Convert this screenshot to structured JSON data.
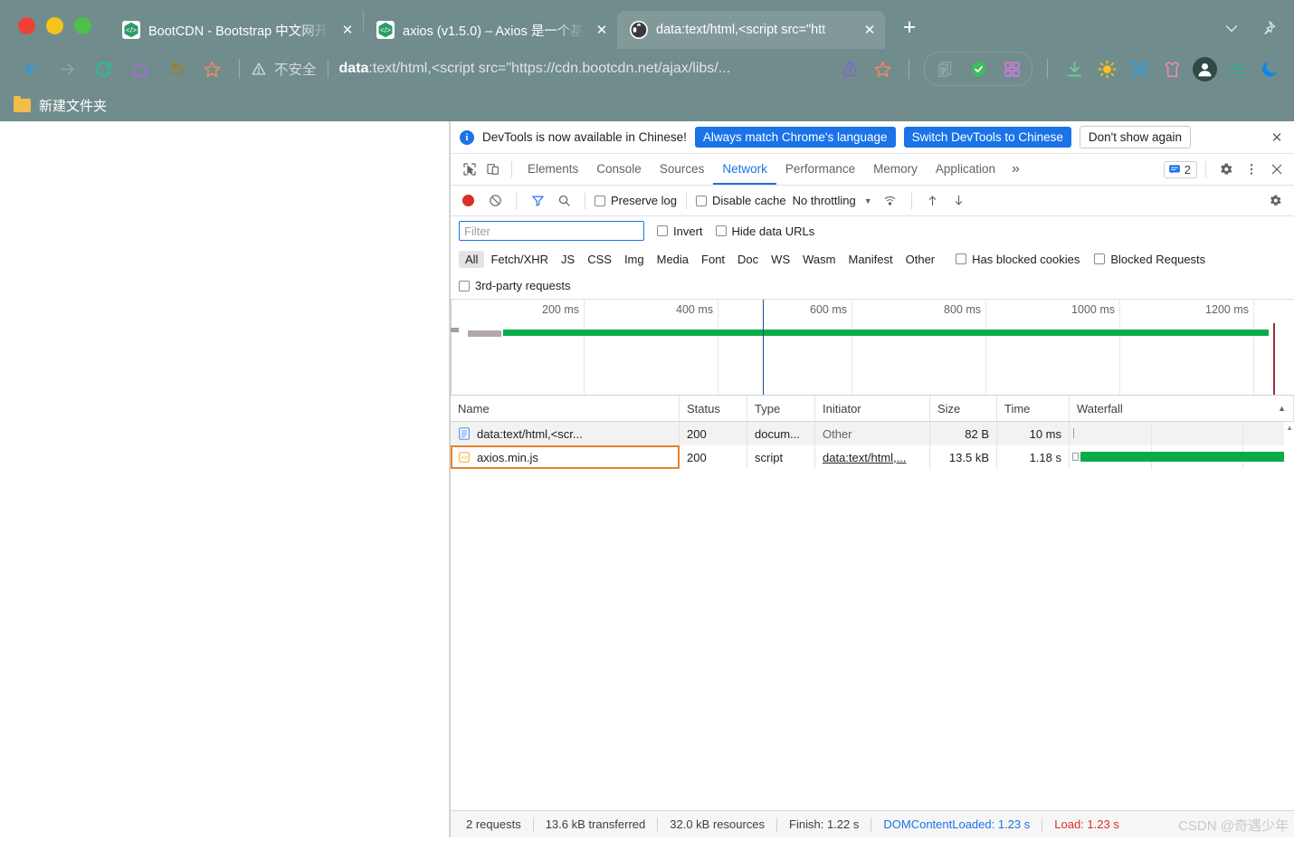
{
  "browser": {
    "tabs": [
      {
        "title": "BootCDN - Bootstrap 中文网开",
        "favicon": "bootcdn-icon",
        "active": false
      },
      {
        "title": "axios (v1.5.0) – Axios 是一个基于",
        "favicon": "bootcdn-icon",
        "active": false
      },
      {
        "title": "data:text/html,<script src=\"htt",
        "favicon": "globe-icon",
        "active": true
      }
    ],
    "close_label": "✕",
    "newtab_label": "+",
    "nav": {
      "back": "back-arrow-icon",
      "forward": "forward-arrow-icon",
      "reload": "reload-icon",
      "home": "home-icon",
      "undo": "undo-icon",
      "bookmark": "star-icon"
    },
    "omnibox": {
      "security_label": "不安全",
      "url_scheme": "data",
      "url_rest": ":text/html,<script src=\"https://cdn.bootcdn.net/ajax/libs/..."
    },
    "bookmarks": [
      {
        "label": "新建文件夹",
        "icon": "folder-icon"
      }
    ]
  },
  "devtools": {
    "infobar": {
      "message": "DevTools is now available in Chinese!",
      "btn_always": "Always match Chrome's language",
      "btn_switch": "Switch DevTools to Chinese",
      "btn_dont": "Don't show again",
      "close": "✕"
    },
    "panels": [
      {
        "label": "Elements",
        "selected": false
      },
      {
        "label": "Console",
        "selected": false
      },
      {
        "label": "Sources",
        "selected": false
      },
      {
        "label": "Network",
        "selected": true
      },
      {
        "label": "Performance",
        "selected": false
      },
      {
        "label": "Memory",
        "selected": false
      },
      {
        "label": "Application",
        "selected": false
      }
    ],
    "more_panels": "»",
    "issues_count": "2",
    "toolbar": {
      "preserve_log": "Preserve log",
      "disable_cache": "Disable cache",
      "throttling": "No throttling",
      "caret": "▼"
    },
    "filter": {
      "placeholder": "Filter",
      "value": "",
      "invert": "Invert",
      "hide_data_urls": "Hide data URLs"
    },
    "types": [
      "All",
      "Fetch/XHR",
      "JS",
      "CSS",
      "Img",
      "Media",
      "Font",
      "Doc",
      "WS",
      "Wasm",
      "Manifest",
      "Other"
    ],
    "selected_type": "All",
    "has_blocked_cookies": "Has blocked cookies",
    "blocked_requests": "Blocked Requests",
    "third_party": "3rd-party requests",
    "overview": {
      "ticks": [
        "200 ms",
        "400 ms",
        "600 ms",
        "800 ms",
        "1000 ms",
        "1200 ms"
      ],
      "dcl_label": "DOMContentLoaded",
      "load_label": "Load"
    },
    "table": {
      "columns": [
        "Name",
        "Status",
        "Type",
        "Initiator",
        "Size",
        "Time",
        "Waterfall"
      ],
      "sort_arrow": "▲",
      "rows": [
        {
          "name": "data:text/html,<scr...",
          "icon": "document-icon",
          "status": "200",
          "type": "docum...",
          "initiator": "Other",
          "initiator_link": false,
          "size": "82 B",
          "time": "10 ms",
          "selected": false
        },
        {
          "name": "axios.min.js",
          "icon": "script-icon",
          "status": "200",
          "type": "script",
          "initiator": "data:text/html,...",
          "initiator_link": true,
          "size": "13.5 kB",
          "time": "1.18 s",
          "selected": true
        }
      ]
    },
    "footer": {
      "requests": "2 requests",
      "transferred": "13.6 kB transferred",
      "resources": "32.0 kB resources",
      "finish": "Finish: 1.22 s",
      "dcl": "DOMContentLoaded: 1.23 s",
      "load": "Load: 1.23 s"
    }
  },
  "watermark": "CSDN @奇遇少年"
}
